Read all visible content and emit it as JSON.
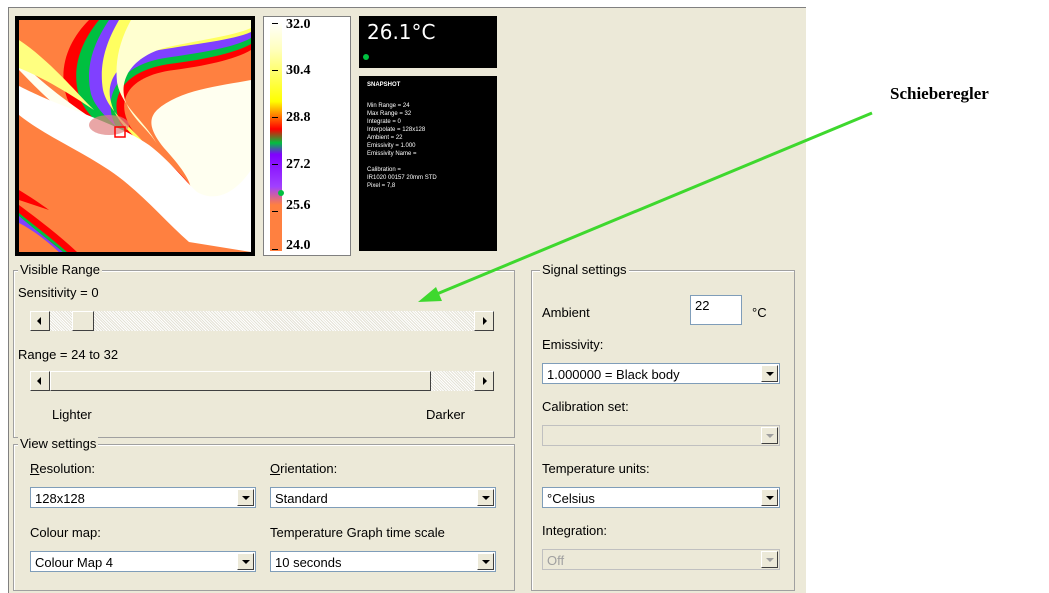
{
  "readout": {
    "temperature": "26.1°C"
  },
  "snapshot": {
    "title": "SNAPSHOT",
    "lines": [
      "Min Range = 24",
      "Max Range = 32",
      "Integrate = 0",
      "Interpolate = 128x128",
      "Ambient = 22",
      "Emissivity = 1.000",
      "Emissivity Name =",
      "",
      "Calibration =",
      "IR1020  00157 20mm STD",
      "Pixel = 7,8"
    ]
  },
  "scale": {
    "labels": [
      "32.0",
      "30.4",
      "28.8",
      "27.2",
      "25.6",
      "24.0"
    ]
  },
  "annotation": {
    "label": "Schieberegler",
    "color": "#3ed82e"
  },
  "visible_range": {
    "title": "Visible Range",
    "sensitivity_label": "Sensitivity = 0",
    "sensitivity_value": 0,
    "range_label": "Range = 24 to 32",
    "lighter_label": "Lighter",
    "darker_label": "Darker"
  },
  "view_settings": {
    "title": "View settings",
    "resolution_label": "Resolution:",
    "resolution_value": "128x128",
    "orientation_label": "Orientation:",
    "orientation_value": "Standard",
    "colour_map_label": "Colour map:",
    "colour_map_value": "Colour Map 4",
    "graph_scale_label": "Temperature Graph time scale",
    "graph_scale_value": "10 seconds"
  },
  "signal_settings": {
    "title": "Signal settings",
    "ambient_label": "Ambient",
    "ambient_value": "22",
    "ambient_unit": "°C",
    "emissivity_label": "Emissivity:",
    "emissivity_value": "1.000000 = Black body",
    "calibration_label": "Calibration set:",
    "calibration_value": "",
    "temp_units_label": "Temperature units:",
    "temp_units_value": "°Celsius",
    "integration_label": "Integration:",
    "integration_value": "Off"
  }
}
